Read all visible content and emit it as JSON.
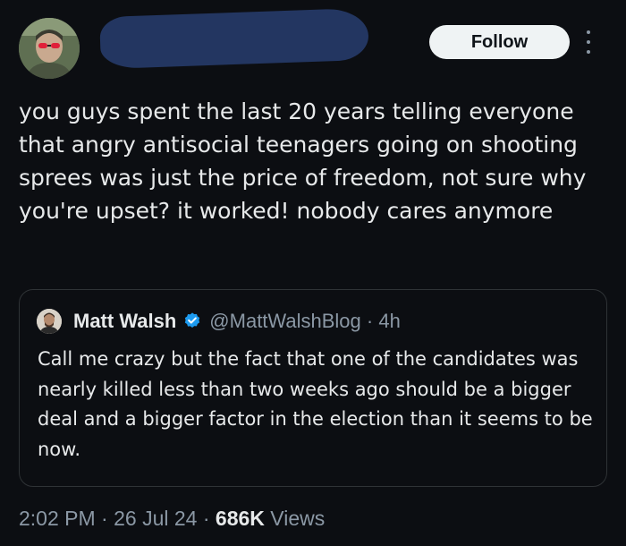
{
  "author": {
    "avatar_icon": "profile-photo-person-with-red-sunglasses",
    "name_redacted": true
  },
  "follow_label": "Follow",
  "more_icon": "more-dots-vertical-icon",
  "tweet": {
    "text": "you guys spent the last 20 years telling everyone that angry antisocial teenagers going on shooting sprees was just the price of freedom, not sure why you're upset? it worked! nobody cares anymore"
  },
  "quoted": {
    "avatar_icon": "profile-photo-person",
    "name": "Matt Walsh",
    "verified_icon": "verified-badge-icon",
    "handle": "@MattWalshBlog",
    "separator": "·",
    "age": "4h",
    "text": "Call me crazy but the fact that one of the candidates was nearly killed less than two weeks ago should be a bigger deal and a bigger factor in the election than it seems to be now."
  },
  "meta": {
    "time": "2:02 PM",
    "sep1": " · ",
    "date": "26 Jul 24",
    "sep2": " · ",
    "views_count": "686K",
    "views_label": " Views"
  },
  "colors": {
    "background": "#0c0e12",
    "text": "#e7e9ea",
    "muted": "#8b98a5",
    "verified": "#1d9bf0",
    "redaction": "#233661"
  }
}
